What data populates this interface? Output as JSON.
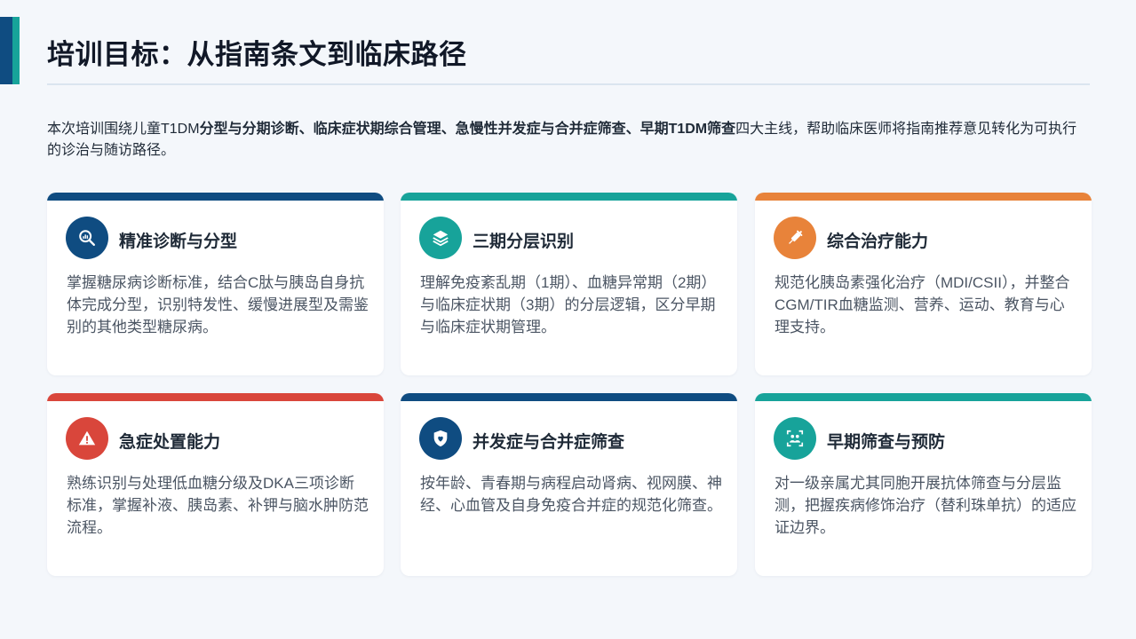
{
  "title": "培训目标：从指南条文到临床路径",
  "intro": [
    {
      "text": "本次培训围绕儿童T1DM",
      "bold": false
    },
    {
      "text": "分型与分期诊断、临床症状期综合管理、急慢性并发症与合并症筛查、早期T1DM筛查",
      "bold": true
    },
    {
      "text": "四大主线，帮助临床医师将指南推荐意见转化为可执行的诊治与随访路径。",
      "bold": false
    }
  ],
  "colors": {
    "navy": "#0f4c81",
    "teal": "#17a39a",
    "orange": "#e8833a",
    "red": "#d9463b"
  },
  "cards": [
    {
      "title": "精准诊断与分型",
      "icon": "magnifier-chart-icon",
      "color": "#0f4c81",
      "desc": "掌握糖尿病诊断标准，结合C肽与胰岛自身抗体完成分型，识别特发性、缓慢进展型及需鉴别的其他类型糖尿病。"
    },
    {
      "title": "三期分层识别",
      "icon": "layers-icon",
      "color": "#17a39a",
      "desc": "理解免疫紊乱期（1期）、血糖异常期（2期）与临床症状期（3期）的分层逻辑，区分早期与临床症状期管理。"
    },
    {
      "title": "综合治疗能力",
      "icon": "syringe-icon",
      "color": "#e8833a",
      "desc": "规范化胰岛素强化治疗（MDI/CSII），并整合CGM/TIR血糖监测、营养、运动、教育与心理支持。"
    },
    {
      "title": "急症处置能力",
      "icon": "warning-icon",
      "color": "#d9463b",
      "desc": "熟练识别与处理低血糖分级及DKA三项诊断标准，掌握补液、胰岛素、补钾与脑水肿防范流程。"
    },
    {
      "title": "并发症与合并症筛查",
      "icon": "shield-heart-icon",
      "color": "#0f4c81",
      "desc": "按年龄、青春期与病程启动肾病、视网膜、神经、心血管及自身免疫合并症的规范化筛查。"
    },
    {
      "title": "早期筛查与预防",
      "icon": "family-scan-icon",
      "color": "#17a39a",
      "desc": "对一级亲属尤其同胞开展抗体筛查与分层监测，把握疾病修饰治疗（替利珠单抗）的适应证边界。"
    }
  ]
}
